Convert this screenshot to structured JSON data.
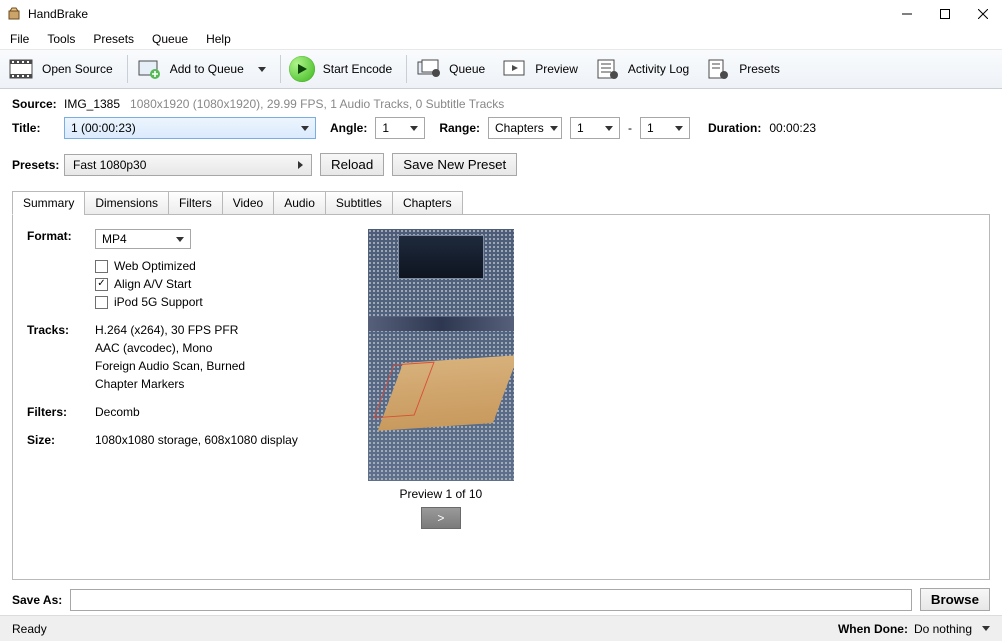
{
  "window": {
    "title": "HandBrake"
  },
  "menu": {
    "file": "File",
    "tools": "Tools",
    "presets": "Presets",
    "queue": "Queue",
    "help": "Help"
  },
  "toolbar": {
    "open_source": "Open Source",
    "add_to_queue": "Add to Queue",
    "start_encode": "Start Encode",
    "queue": "Queue",
    "preview": "Preview",
    "activity_log": "Activity Log",
    "presets": "Presets"
  },
  "source": {
    "label": "Source:",
    "name": "IMG_1385",
    "info": "1080x1920 (1080x1920), 29.99 FPS, 1 Audio Tracks, 0 Subtitle Tracks"
  },
  "title_row": {
    "title_label": "Title:",
    "title_value": "1 (00:00:23)",
    "angle_label": "Angle:",
    "angle_value": "1",
    "range_label": "Range:",
    "range_mode": "Chapters",
    "chap_from": "1",
    "chap_to": "1",
    "duration_label": "Duration:",
    "duration_value": "00:00:23"
  },
  "presets_row": {
    "label": "Presets:",
    "value": "Fast 1080p30",
    "reload": "Reload",
    "save_new": "Save New Preset"
  },
  "tabs": {
    "summary": "Summary",
    "dimensions": "Dimensions",
    "filters": "Filters",
    "video": "Video",
    "audio": "Audio",
    "subtitles": "Subtitles",
    "chapters": "Chapters"
  },
  "summary": {
    "format_label": "Format:",
    "format_value": "MP4",
    "web_optimized": "Web Optimized",
    "align_av": "Align A/V Start",
    "ipod": "iPod 5G Support",
    "tracks_label": "Tracks:",
    "tracks_l1": "H.264 (x264), 30 FPS PFR",
    "tracks_l2": "AAC (avcodec), Mono",
    "tracks_l3": "Foreign Audio Scan, Burned",
    "tracks_l4": "Chapter Markers",
    "filters_label": "Filters:",
    "filters_val": "Decomb",
    "size_label": "Size:",
    "size_val": "1080x1080 storage, 608x1080 display",
    "preview_caption": "Preview 1 of 10",
    "next": ">"
  },
  "saveas": {
    "label": "Save As:",
    "value": "",
    "browse": "Browse"
  },
  "status": {
    "ready": "Ready",
    "when_done_label": "When Done:",
    "when_done_value": "Do nothing"
  }
}
